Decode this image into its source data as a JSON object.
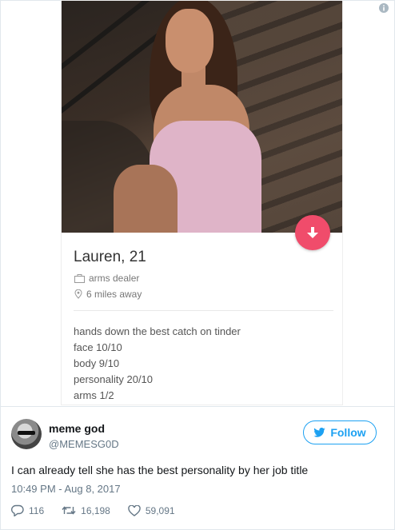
{
  "profile": {
    "name": "Lauren, 21",
    "job": "arms dealer",
    "distance": "6 miles away",
    "bio": [
      "hands down the best catch on tinder",
      "face 10/10",
      "body 9/10",
      "personality 20/10",
      "arms 1/2"
    ]
  },
  "tweet": {
    "display_name": "meme god",
    "handle": "@MEMESG0D",
    "follow_label": "Follow",
    "text": "I can already tell she has the best personality by her job title",
    "timestamp": "10:49 PM - Aug 8, 2017",
    "replies": "116",
    "retweets": "16,198",
    "likes": "59,091"
  },
  "colors": {
    "twitter_blue": "#1da1f2",
    "tinder_dislike": "#f04c6b",
    "muted_text": "#657786"
  },
  "icons": [
    "info-icon",
    "arrow-down-icon",
    "briefcase-icon",
    "location-pin-icon",
    "twitter-bird-icon",
    "reply-icon",
    "retweet-icon",
    "heart-icon"
  ]
}
